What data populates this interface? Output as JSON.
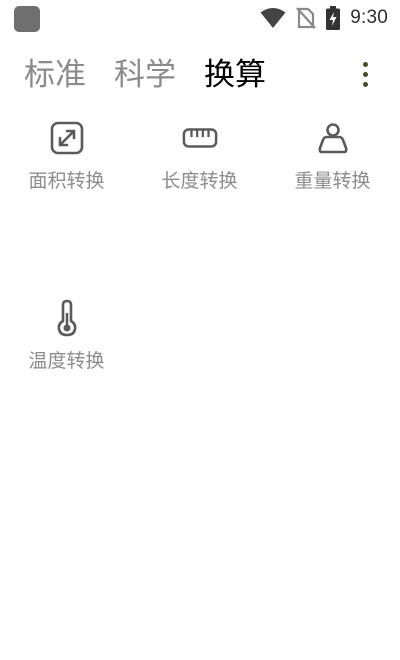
{
  "status_bar": {
    "time": "9:30",
    "icons": [
      "app-indicator-icon",
      "wifi-icon",
      "no-sim-icon",
      "battery-charging-icon"
    ]
  },
  "tabs": [
    {
      "label": "标准",
      "active": false
    },
    {
      "label": "科学",
      "active": false
    },
    {
      "label": "换算",
      "active": true
    }
  ],
  "menu": {
    "icon": "more-vertical-icon"
  },
  "converters": [
    {
      "label": "面积转换",
      "icon": "area-icon"
    },
    {
      "label": "长度转换",
      "icon": "ruler-icon"
    },
    {
      "label": "重量转换",
      "icon": "weight-icon"
    },
    {
      "label": "温度转换",
      "icon": "thermometer-icon"
    }
  ],
  "colors": {
    "icon": "#5a5a5a",
    "label": "#8c8c8c",
    "tab_inactive": "#8b8b8b",
    "tab_active": "#000000"
  }
}
